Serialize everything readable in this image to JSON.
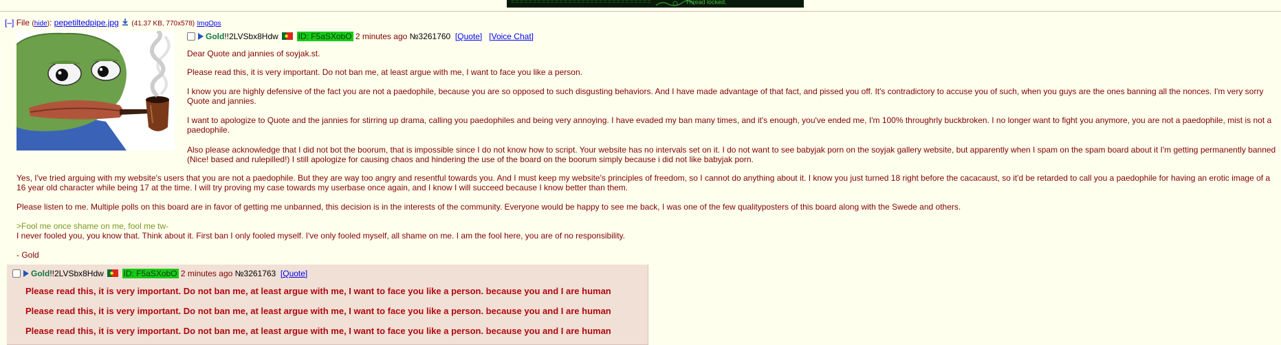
{
  "banner": {
    "equals_text": "================================",
    "locked_text": "Thread locked."
  },
  "file": {
    "toggle": "[–]",
    "label": "File",
    "hide": "hide",
    "filename": "pepetiltedpipe.jpg",
    "meta": "(41.37 KB, 770x578)",
    "imgops": "ImgOps"
  },
  "op": {
    "name": "Gold",
    "trip": "!!2LVSbx8Hdw",
    "id": "ID: F5aSXobO",
    "time": "2 minutes ago",
    "number": "№3261760",
    "quote_link": "[Quote]",
    "voice_link": "[Voice Chat]",
    "paragraphs": [
      "Dear Quote and jannies of soyjak.st.",
      "Please read this, it is very important. Do not ban me, at least argue with me, I want to face you like a person.",
      "I know you are highly defensive of the fact you are not a paedophile, because you are so opposed to such disgusting behaviors. And I have made advantage of that fact, and pissed you off. It's contradictory to accuse you of such, when you guys are the ones banning all the nonces. I'm very sorry Quote and jannies.",
      "I want to apologize to Quote and the jannies for stirring up drama, calling you paedophiles and being very annoying. I have evaded my ban many times, and it's enough, you've ended me, I'm 100% throughrly buckbroken. I no longer want to fight you anymore, you are not a paedophile, mist is not a paedophile.",
      "Also please acknowledge that I did not bot the boorum, that is impossible since I do not know how to script. Your website has no intervals set on it. I do not want to see babyjak porn on the soyjak gallery website, but apparently when I spam on the spam board about it I'm getting permanently banned (Nice! based and rulepilled!) I still apologize for causing chaos and hindering the use of the board on the boorum simply because i did not like babyjak porn.",
      "Yes, I've tried arguing with my website's users that you are not a paedophile. But they are way too angry and resentful towards you. And I must keep my website's principles of freedom, so I cannot do anything about it. I know you just turned 18 right before the cacacaust, so it'd be retarded to call you a paedophile for having an erotic image of a 16 year old character while being 17 at the time. I will try proving my case towards my userbase once again, and I know I will succeed because I know better than them.",
      "Please listen to me. Multiple polls on this board are in favor of getting me unbanned, this decision is in the interests of the community. Everyone would be happy to see me back, I was one of the few qualityposters of this board along with the Swede and others.",
      ">Fool me once shame on me, fool me tw-",
      "I never fooled you, you know that. Think about it. First ban I only fooled myself. I've only fooled myself, all shame on me. I am the fool here, you are of no responsibility.",
      "- Gold"
    ]
  },
  "reply": {
    "name": "Gold",
    "trip": "!!2LVSbx8Hdw",
    "id": "ID: F5aSXobO",
    "time": "2 minutes ago",
    "number": "№3261763",
    "quote_link": "[Quote]",
    "lines": [
      "Please read this, it is very important. Do not ban me, at least argue with me, I want to face you like a person. because you and I are human",
      "Please read this, it is very important. Do not ban me, at least argue with me, I want to face you like a person. because you and I are human",
      "Please read this, it is very important. Do not ban me, at least argue with me, I want to face you like a person. because you and I are human"
    ]
  },
  "colors": {
    "page_bg": "#ffffee",
    "post_text": "#800000",
    "name": "#117743",
    "id_bg": "#15cc15",
    "greentext": "#789922",
    "reply_bg": "#f0e0d6",
    "bold_red": "#af0a0f"
  }
}
